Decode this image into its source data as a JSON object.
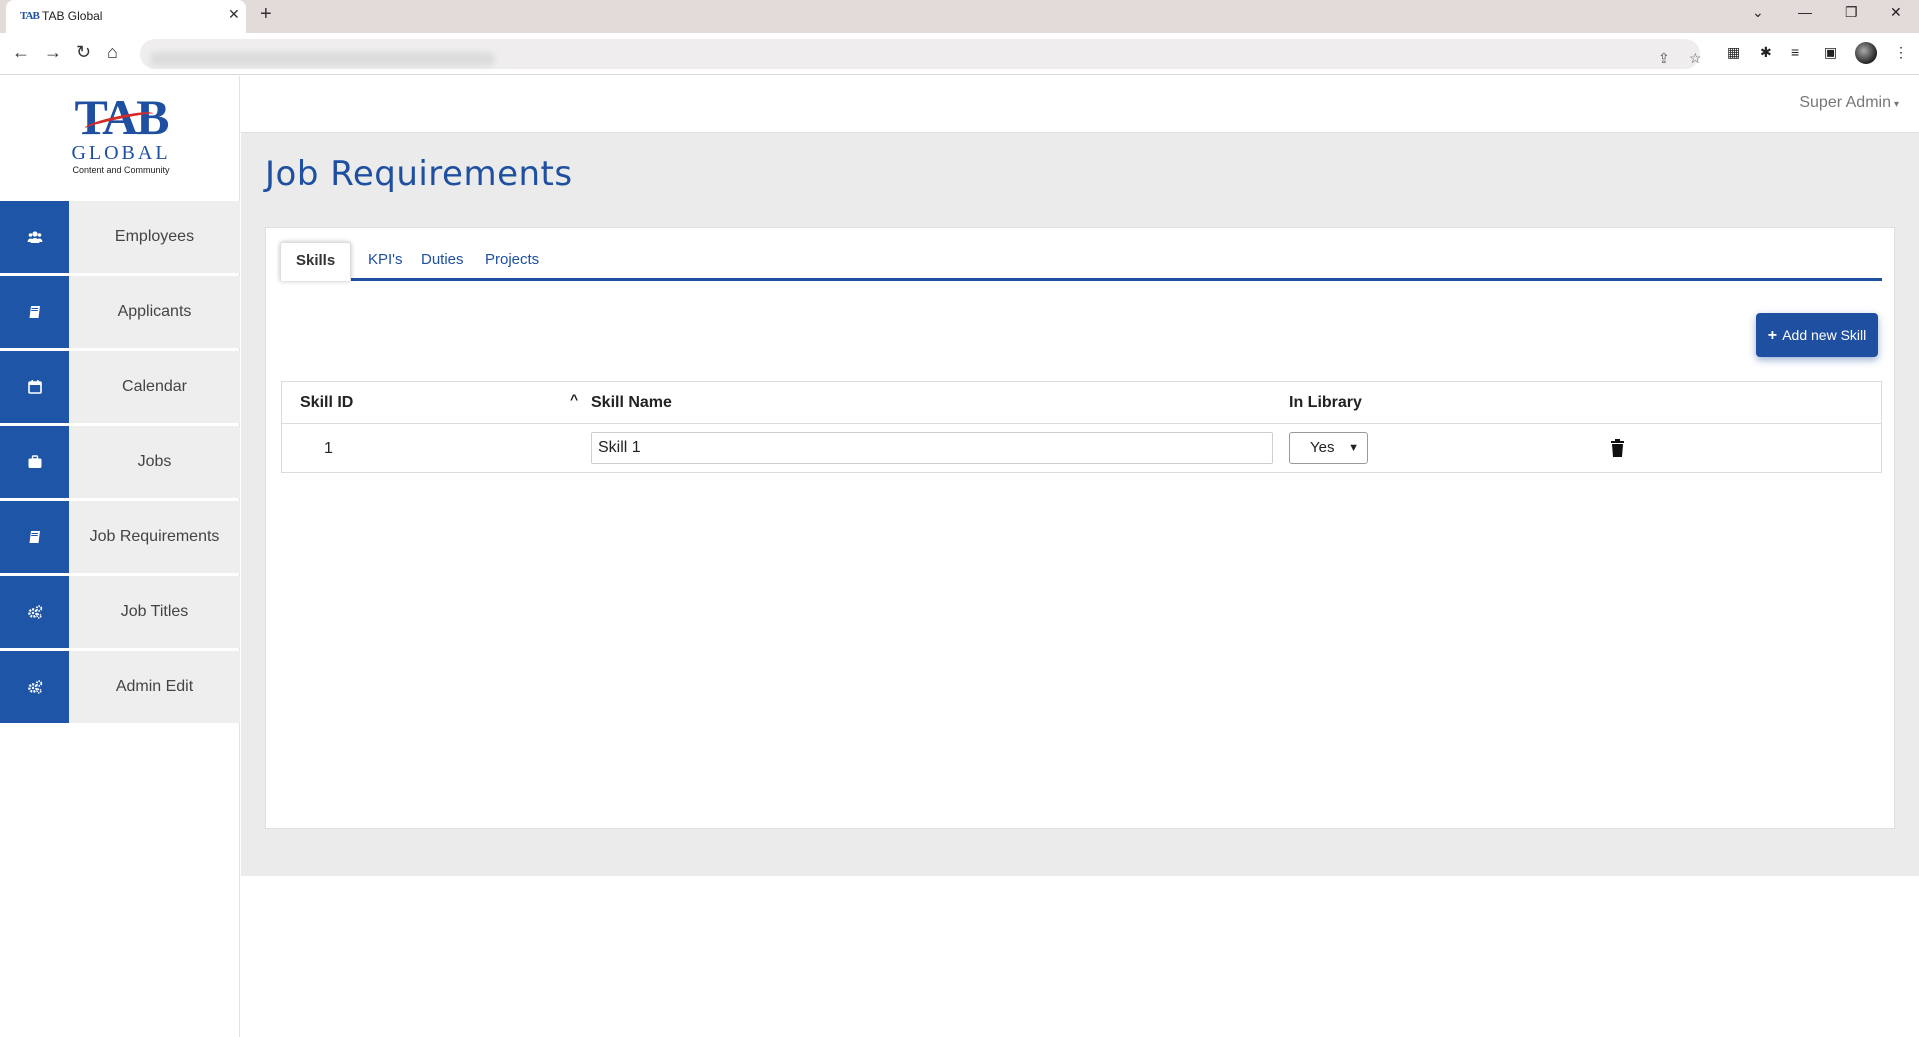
{
  "browser": {
    "tab_favicon": "TAB",
    "tab_title": "TAB Global",
    "tab_close": "✕",
    "new_tab": "+",
    "window_controls": [
      "⌄",
      "—",
      "❐",
      "✕"
    ]
  },
  "toolbar": {
    "back": "←",
    "forward": "→",
    "reload": "↻",
    "home": "⌂"
  },
  "logo": {
    "tab": "TAB",
    "global": "GLOBAL",
    "subtitle": "Content and Community"
  },
  "sidebar": {
    "items": [
      {
        "label": "Employees",
        "icon": "users-icon"
      },
      {
        "label": "Applicants",
        "icon": "book-icon"
      },
      {
        "label": "Calendar",
        "icon": "calendar-icon"
      },
      {
        "label": "Jobs",
        "icon": "briefcase-icon"
      },
      {
        "label": "Job Requirements",
        "icon": "book-icon"
      },
      {
        "label": "Job Titles",
        "icon": "gears-icon"
      },
      {
        "label": "Admin Edit",
        "icon": "gears-icon"
      }
    ]
  },
  "header": {
    "user": "Super Admin",
    "caret": "▾"
  },
  "page": {
    "title": "Job Requirements"
  },
  "tabs": [
    {
      "label": "Skills",
      "active": true
    },
    {
      "label": "KPI's",
      "active": false
    },
    {
      "label": "Duties",
      "active": false
    },
    {
      "label": "Projects",
      "active": false
    }
  ],
  "add_button": {
    "plus": "+",
    "label": "Add new Skill"
  },
  "table": {
    "columns": [
      "Skill ID",
      "Skill Name",
      "In Library"
    ],
    "sort_indicator": "^",
    "rows": [
      {
        "id": "1",
        "name": "Skill 1",
        "in_library": "Yes"
      }
    ]
  },
  "colors": {
    "accent": "#1e4fa1",
    "sidebar_icon_bg": "#1e55a6",
    "nav_bg": "#eeeeee",
    "content_bg": "#ebebeb"
  }
}
